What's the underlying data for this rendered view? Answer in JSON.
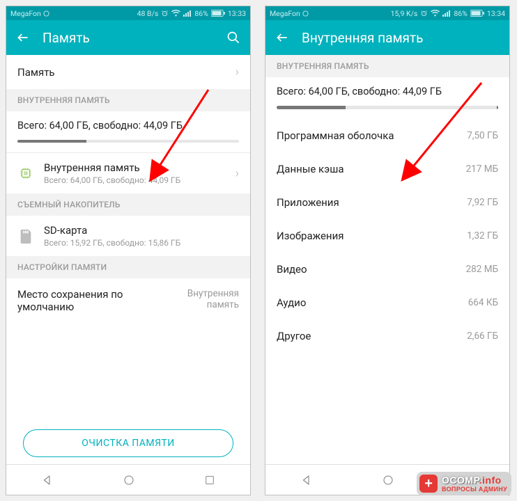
{
  "left": {
    "status": {
      "carrier": "MegaFon",
      "speed": "48 B/s",
      "battery": "86%",
      "time": "13:33"
    },
    "appbar": {
      "title": "Память"
    },
    "nav_memory": "Память",
    "sections": {
      "internal_header": "ВНУТРЕННЯЯ ПАМЯТЬ",
      "removable_header": "СЪЕМНЫЙ НАКОПИТЕЛЬ",
      "settings_header": "НАСТРОЙКИ ПАМЯТИ"
    },
    "summary": {
      "text": "Всего: 64,00 ГБ, свободно: 44,09 ГБ",
      "fill_percent": 31
    },
    "internal_item": {
      "label": "Внутренняя память",
      "sub": "Всего: 64,00 ГБ, свободно: 44,09 ГБ"
    },
    "sd_item": {
      "label": "SD-карта",
      "sub": "Всего: 15,92 ГБ, свободно: 15,86 ГБ"
    },
    "default_location": {
      "label": "Место сохранения по умолчанию",
      "value": "Внутренняя память"
    },
    "clean_button": "ОЧИСТКА ПАМЯТИ"
  },
  "right": {
    "status": {
      "carrier": "MegaFon",
      "speed": "15,9 K/s",
      "battery": "86%",
      "time": "13:34"
    },
    "appbar": {
      "title": "Внутренняя память"
    },
    "section_header": "ВНУТРЕННЯЯ ПАМЯТЬ",
    "summary": {
      "text": "Всего: 64,00 ГБ, свободно: 44,09 ГБ",
      "fill_percent": 31
    },
    "rows": [
      {
        "label": "Программная оболочка",
        "value": "7,50 ГБ"
      },
      {
        "label": "Данные кэша",
        "value": "217 МБ"
      },
      {
        "label": "Приложения",
        "value": "7,92 ГБ"
      },
      {
        "label": "Изображения",
        "value": "1,32 ГБ"
      },
      {
        "label": "Видео",
        "value": "282 МБ"
      },
      {
        "label": "Аудио",
        "value": "664 КБ"
      },
      {
        "label": "Другое",
        "value": "2,66 ГБ"
      }
    ]
  },
  "watermark": {
    "brand": "OCOMP",
    "suffix": ".info",
    "tagline": "ВОПРОСЫ АДМИНУ"
  }
}
